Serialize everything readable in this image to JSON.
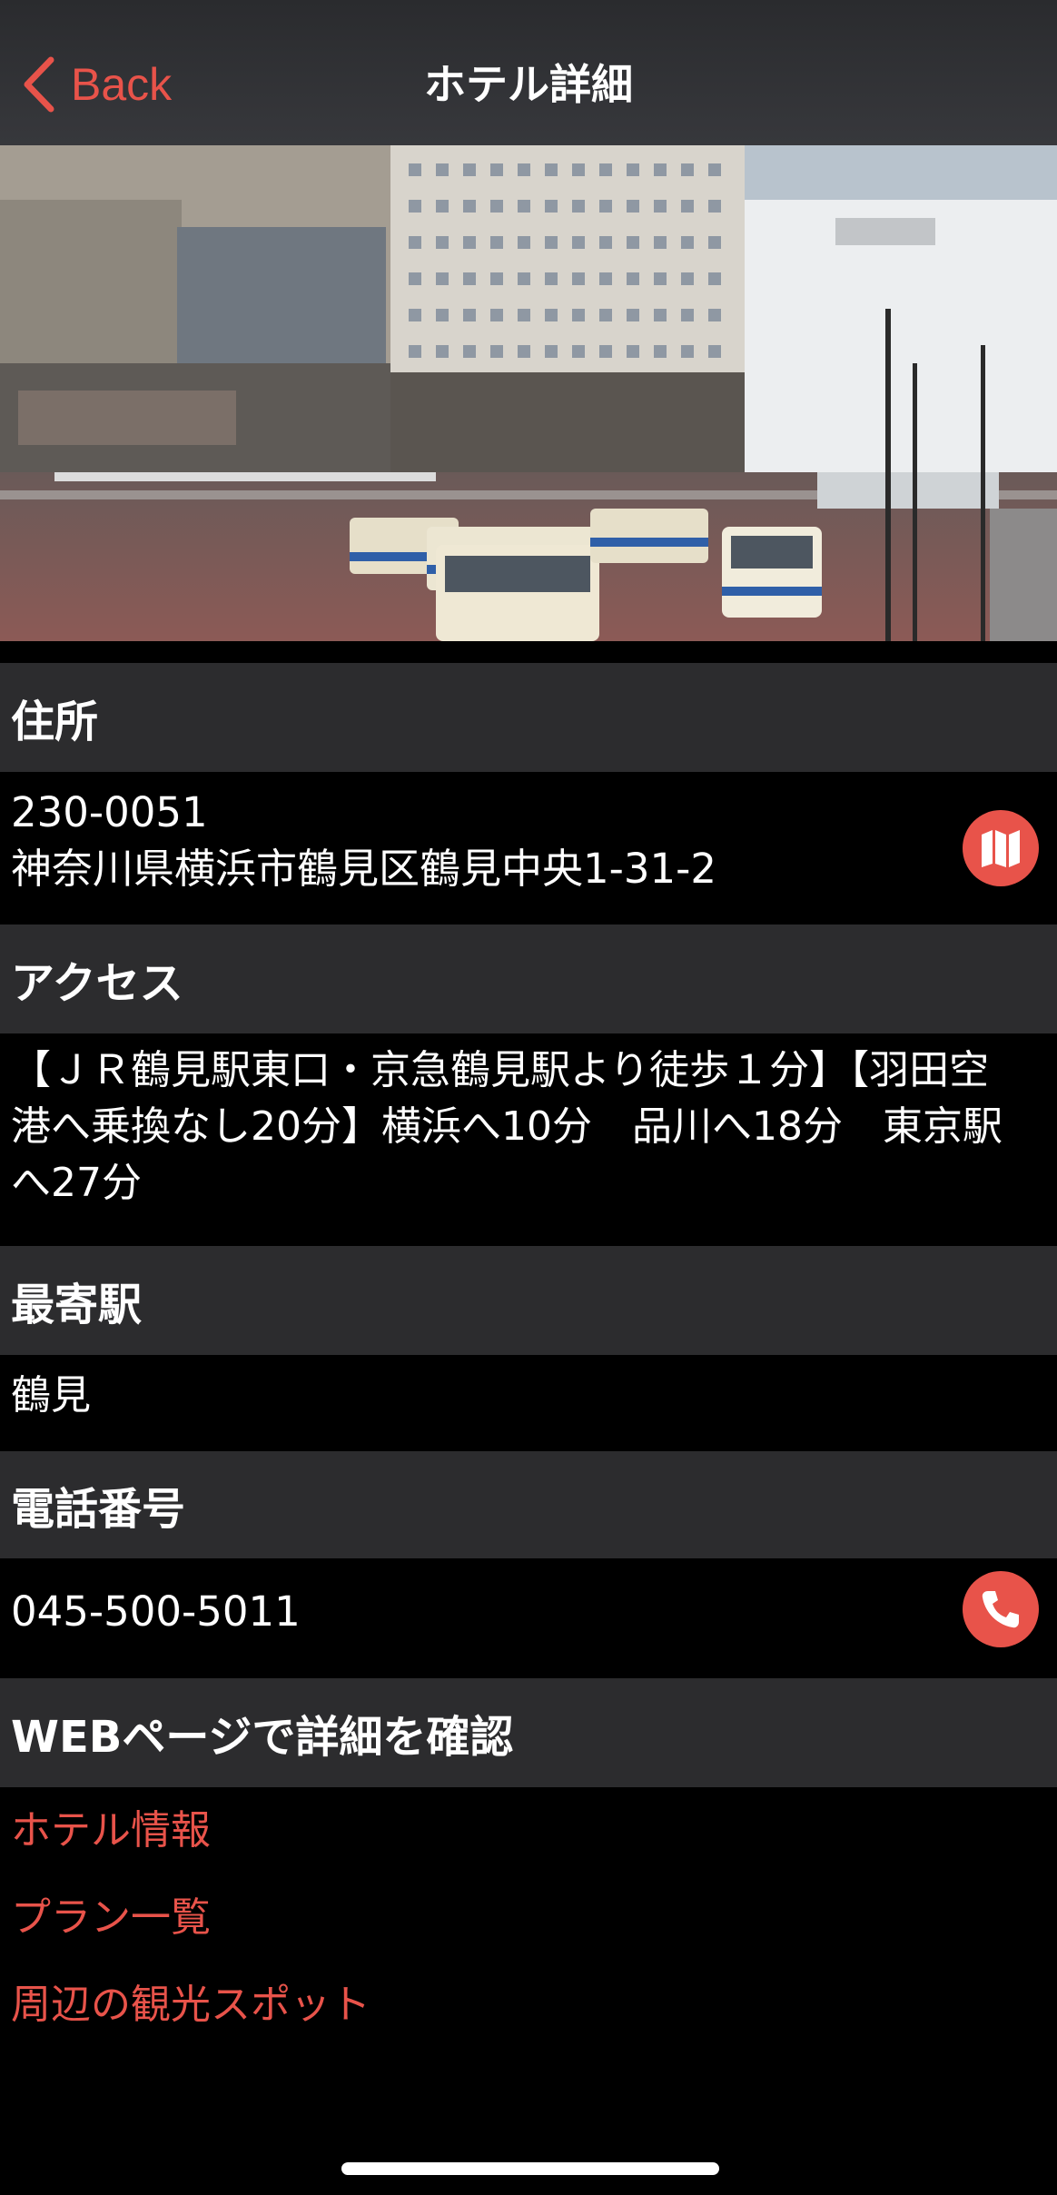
{
  "nav": {
    "back_label": "Back",
    "title": "ホテル詳細"
  },
  "address": {
    "header": "住所",
    "postal_code": "230-0051",
    "line": "神奈川県横浜市鶴見区鶴見中央1-31-2",
    "map_icon": "map-icon"
  },
  "access": {
    "header": "アクセス",
    "line1": "【ＪＲ鶴見駅東口・京急鶴見駅より徒歩１分】【羽田空",
    "line2": "港へ乗換なし20分】横浜へ10分　品川へ18分　東京駅",
    "line3": "へ27分"
  },
  "station": {
    "header": "最寄駅",
    "value": "鶴見"
  },
  "phone": {
    "header": "電話番号",
    "value": "045-500-5011",
    "call_icon": "phone-icon"
  },
  "web": {
    "header": "WEBページで詳細を確認",
    "links": [
      "ホテル情報",
      "プラン一覧",
      "周辺の観光スポット"
    ]
  },
  "colors": {
    "accent": "#e8534a",
    "section_header_bg": "#2c2c2e",
    "background": "#000000"
  }
}
